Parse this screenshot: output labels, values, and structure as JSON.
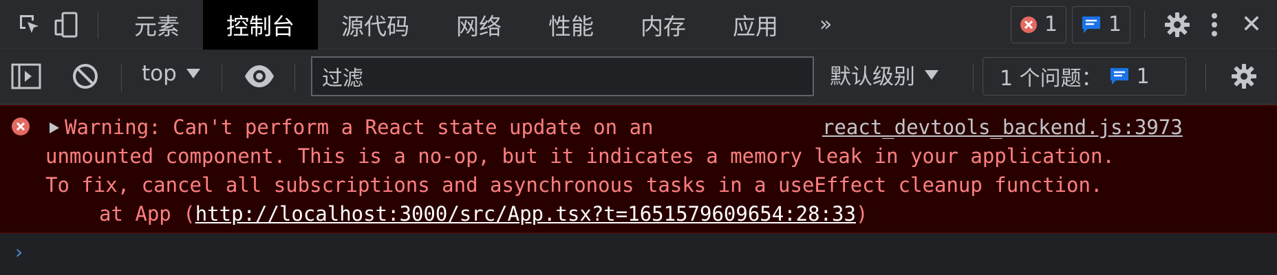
{
  "tabs": [
    {
      "label": "元素"
    },
    {
      "label": "控制台"
    },
    {
      "label": "源代码"
    },
    {
      "label": "网络"
    },
    {
      "label": "性能"
    },
    {
      "label": "内存"
    },
    {
      "label": "应用"
    }
  ],
  "more_tabs": "»",
  "badges": {
    "errors": "1",
    "messages": "1"
  },
  "close": "✕",
  "toolbar": {
    "context": "top",
    "filter_placeholder": "过滤",
    "levels_label": "默认级别",
    "issues_label": "1 个问题：",
    "issues_count": "1"
  },
  "message": {
    "text_line1": "Warning: Can't perform a React state update on an",
    "source_link": "react_devtools_backend.js:3973",
    "text_line2": "unmounted component. This is a no-op, but it indicates a memory leak in your application.",
    "text_line3": "To fix, cancel all subscriptions and asynchronous tasks in a useEffect cleanup function.",
    "stack_prefix": "at App (",
    "stack_url": "http://localhost:3000/src/App.tsx?t=1651579609654:28:33",
    "stack_suffix": ")"
  },
  "prompt": "›",
  "colors": {
    "error": "#e46962",
    "accent": "#1a73e8"
  }
}
